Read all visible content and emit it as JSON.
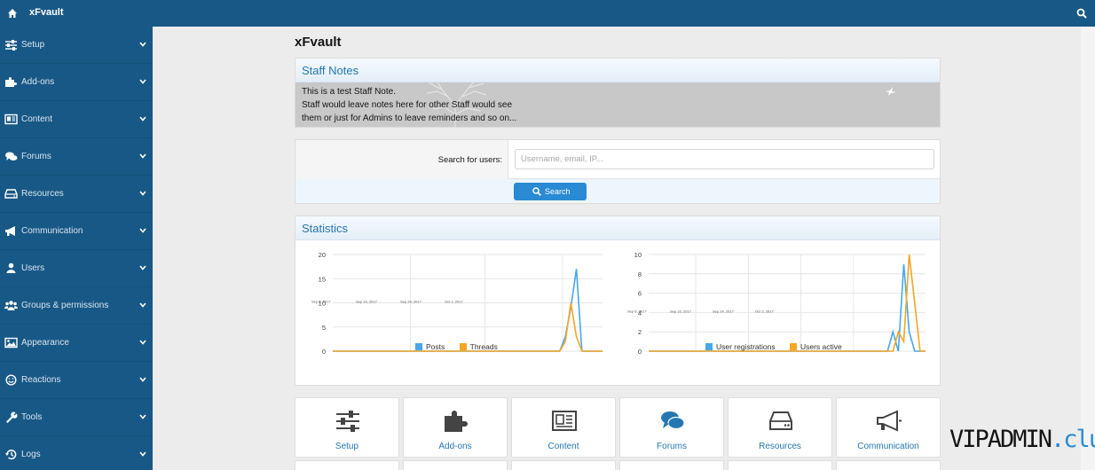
{
  "app": {
    "title": "xFvault"
  },
  "sidebar": {
    "items": [
      {
        "label": "Setup",
        "icon": "sliders-icon"
      },
      {
        "label": "Add-ons",
        "icon": "puzzle-icon"
      },
      {
        "label": "Content",
        "icon": "newspaper-icon"
      },
      {
        "label": "Forums",
        "icon": "comments-icon"
      },
      {
        "label": "Resources",
        "icon": "hdd-icon"
      },
      {
        "label": "Communication",
        "icon": "bullhorn-icon"
      },
      {
        "label": "Users",
        "icon": "user-icon"
      },
      {
        "label": "Groups & permissions",
        "icon": "users-icon"
      },
      {
        "label": "Appearance",
        "icon": "image-icon"
      },
      {
        "label": "Reactions",
        "icon": "smile-icon"
      },
      {
        "label": "Tools",
        "icon": "wrench-icon"
      },
      {
        "label": "Logs",
        "icon": "history-icon"
      }
    ]
  },
  "main": {
    "title": "xFvault",
    "staff_notes": {
      "heading": "Staff Notes",
      "lines": [
        "This is a test Staff Note.",
        "Staff would leave notes here for other Staff would see",
        "them or just for Admins to leave reminders and so on..."
      ]
    },
    "user_search": {
      "label": "Search for users:",
      "placeholder": "Username, email, IP...",
      "button": "Search"
    },
    "statistics": {
      "heading": "Statistics"
    },
    "tiles": [
      {
        "label": "Setup",
        "icon": "sliders-icon"
      },
      {
        "label": "Add-ons",
        "icon": "puzzle-icon"
      },
      {
        "label": "Content",
        "icon": "newspaper-icon"
      },
      {
        "label": "Forums",
        "icon": "comments-icon"
      },
      {
        "label": "Resources",
        "icon": "hdd-icon"
      },
      {
        "label": "Communication",
        "icon": "bullhorn-icon"
      }
    ]
  },
  "watermark": {
    "part1": "VIPADMIN",
    "part2": ".club"
  },
  "colors": {
    "brand": "#185886",
    "accent": "#2577b1",
    "button": "#2a8ad3",
    "series_blue": "#47a7eb",
    "series_orange": "#f5a623"
  },
  "chart_data": [
    {
      "type": "line",
      "x_tick_labels": [
        "Sep 8, 2017",
        "Sep 16, 2017",
        "Sep 24, 2017",
        "Oct 2, 2017"
      ],
      "ylim": [
        0,
        20
      ],
      "y_ticks": [
        0,
        5,
        10,
        15,
        20
      ],
      "grid": true,
      "legend": "bottom",
      "series": [
        {
          "name": "Posts",
          "color": "#47a7eb",
          "values": [
            0,
            0,
            0,
            0,
            0,
            0,
            0,
            0,
            0,
            0,
            0,
            0,
            0,
            0,
            0,
            0,
            0,
            0,
            0,
            0,
            0,
            0,
            0,
            0,
            0,
            0,
            0,
            0,
            0,
            0,
            0,
            0,
            0,
            0,
            0,
            0,
            0,
            0,
            0,
            0,
            0,
            0,
            3,
            9,
            17,
            0,
            0,
            0,
            0,
            0,
            0
          ]
        },
        {
          "name": "Threads",
          "color": "#f5a623",
          "values": [
            0,
            0,
            0,
            0,
            0,
            0,
            0,
            0,
            0,
            0,
            0,
            0,
            0,
            0,
            0,
            0,
            0,
            0,
            0,
            0,
            0,
            0,
            0,
            0,
            0,
            0,
            0,
            0,
            0,
            0,
            0,
            0,
            0,
            0,
            0,
            0,
            0,
            0,
            0,
            0,
            0,
            0,
            2,
            10,
            3,
            0,
            0,
            0,
            0,
            0,
            0
          ]
        }
      ]
    },
    {
      "type": "line",
      "x_tick_labels": [
        "Sep 8, 2017",
        "Sep 16, 2017",
        "Sep 24, 2017",
        "Oct 2, 2017"
      ],
      "ylim": [
        0,
        10
      ],
      "y_ticks": [
        0,
        2,
        4,
        6,
        8,
        10
      ],
      "grid": true,
      "legend": "bottom",
      "series": [
        {
          "name": "User registrations",
          "color": "#47a7eb",
          "values": [
            0,
            0,
            0,
            0,
            0,
            0,
            0,
            0,
            0,
            0,
            0,
            0,
            0,
            0,
            0,
            0,
            0,
            0,
            0,
            0,
            0,
            0,
            0,
            0,
            0,
            0,
            0,
            0,
            0,
            0,
            0,
            0,
            0,
            0,
            0,
            0,
            0,
            0,
            0,
            0,
            0,
            0,
            0,
            0,
            0,
            2,
            0,
            9,
            2,
            0,
            0,
            0
          ]
        },
        {
          "name": "Users active",
          "color": "#f5a623",
          "values": [
            0,
            0,
            0,
            0,
            0,
            0,
            0,
            0,
            0,
            0,
            0,
            0,
            0,
            0,
            0,
            0,
            0,
            0,
            0,
            0,
            0,
            0,
            0,
            0,
            0,
            0,
            0,
            0,
            0,
            0,
            0,
            0,
            0,
            0,
            0,
            0,
            0,
            0,
            0,
            0,
            0,
            0,
            0,
            0,
            0,
            0,
            2,
            1,
            10,
            5,
            0,
            0
          ]
        }
      ]
    }
  ]
}
